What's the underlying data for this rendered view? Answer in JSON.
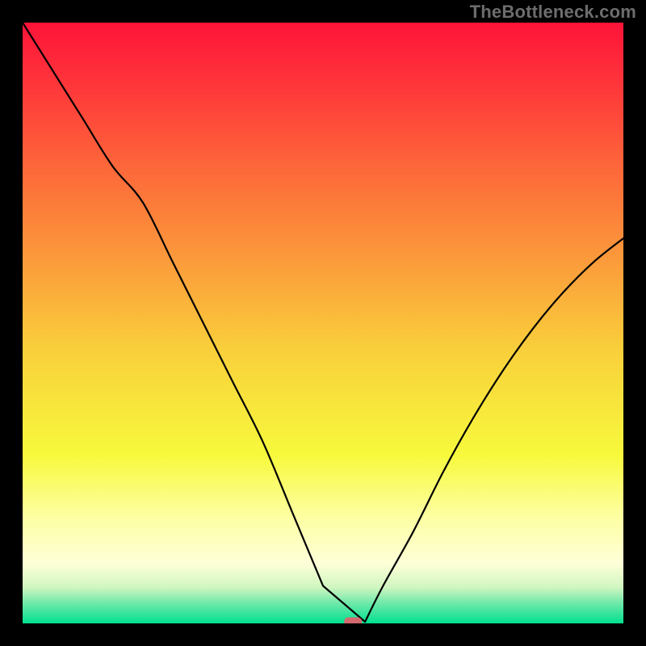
{
  "watermark": "TheBottleneck.com",
  "chart_data": {
    "type": "line",
    "title": "",
    "xlabel": "",
    "ylabel": "",
    "xlim": [
      0,
      100
    ],
    "ylim": [
      0,
      100
    ],
    "grid": false,
    "legend": false,
    "gradient_stops": [
      {
        "offset": 0.0,
        "color": "#fe1339"
      },
      {
        "offset": 0.12,
        "color": "#fe3c3a"
      },
      {
        "offset": 0.25,
        "color": "#fd6a3a"
      },
      {
        "offset": 0.4,
        "color": "#fb9c3b"
      },
      {
        "offset": 0.55,
        "color": "#f9d13b"
      },
      {
        "offset": 0.72,
        "color": "#f7f93c"
      },
      {
        "offset": 0.82,
        "color": "#fdffa0"
      },
      {
        "offset": 0.9,
        "color": "#feffd8"
      },
      {
        "offset": 0.94,
        "color": "#d0f6c0"
      },
      {
        "offset": 0.965,
        "color": "#74e9ab"
      },
      {
        "offset": 1.0,
        "color": "#00e08f"
      }
    ],
    "series": [
      {
        "name": "bottleneck-curve",
        "x": [
          0,
          5,
          10,
          15,
          20,
          25,
          30,
          35,
          40,
          45,
          50,
          52,
          55,
          57,
          60,
          65,
          70,
          75,
          80,
          85,
          90,
          95,
          100
        ],
        "y": [
          100,
          92,
          84,
          76,
          70,
          60,
          50,
          40,
          30,
          18,
          6,
          0,
          0,
          0,
          6,
          15,
          25,
          34,
          42,
          49,
          55,
          60,
          64
        ]
      }
    ],
    "curve_flat_segment": {
      "x_start": 50,
      "x_end": 57,
      "y": 0
    },
    "marker": {
      "x": 55,
      "y": 0,
      "shape": "rounded-rect",
      "color": "#d3696e"
    }
  }
}
